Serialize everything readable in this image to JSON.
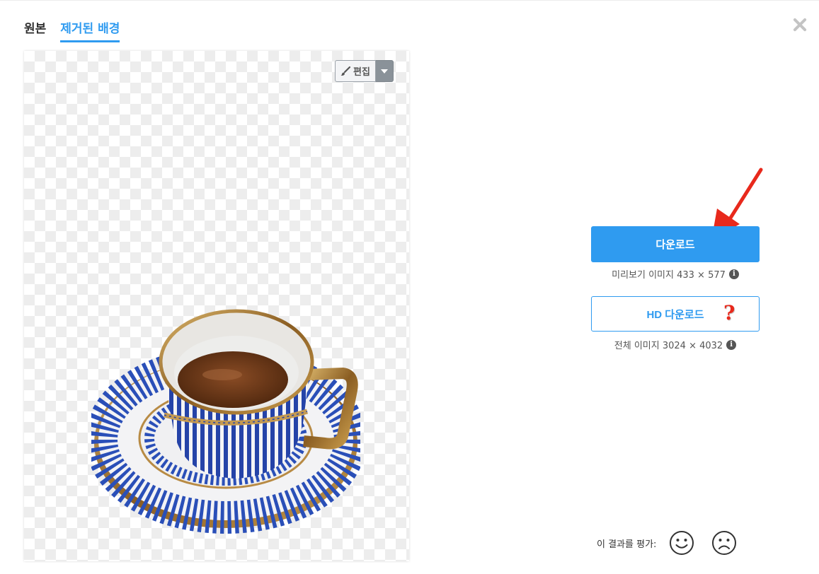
{
  "tabs": [
    {
      "label": "원본",
      "active": false
    },
    {
      "label": "제거된 배경",
      "active": true
    }
  ],
  "editor": {
    "edit_label": "편집",
    "brush_icon": "brush-icon",
    "dropdown_icon": "chevron-down-icon"
  },
  "download": {
    "button_label": "다운로드",
    "preview_info": "미리보기 이미지 433 × 577",
    "hd_button_label": "HD 다운로드",
    "hd_marker": "?",
    "full_info": "전체 이미지 3024 × 4032",
    "info_icon": "i"
  },
  "rating": {
    "label": "이 결과를 평가:",
    "positive_icon": "smiley-face-icon",
    "negative_icon": "frowning-face-icon"
  },
  "colors": {
    "accent": "#2f9bf0",
    "annotation_red": "#e8291c",
    "checker": "#ededed"
  }
}
